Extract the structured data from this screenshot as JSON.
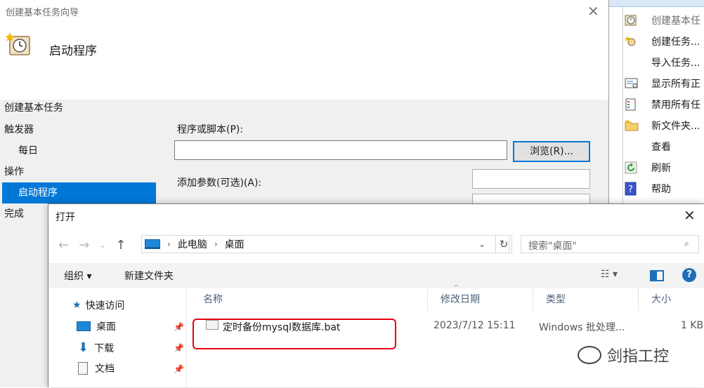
{
  "wizard": {
    "title": "创建基本任务向导",
    "header_title": "启动程序",
    "nav_heading": "创建基本任务",
    "nav_items": [
      {
        "label": "触发器"
      },
      {
        "label": "每日"
      },
      {
        "label": "操作"
      },
      {
        "label": "启动程序"
      },
      {
        "label": "完成"
      }
    ],
    "program_label": "程序或脚本(P):",
    "program_value": "",
    "browse_label": "浏览(R)...",
    "args_label": "添加参数(可选)(A):",
    "args_value": ""
  },
  "action_pane": {
    "items": [
      {
        "label": "创建基本任",
        "icon": "task-wizard-icon",
        "disabled": true
      },
      {
        "label": "创建任务...",
        "icon": "create-task-icon",
        "disabled": false
      },
      {
        "label": "导入任务...",
        "icon": "",
        "disabled": false
      },
      {
        "label": "显示所有正",
        "icon": "running-tasks-icon",
        "disabled": false
      },
      {
        "label": "禁用所有任",
        "icon": "disable-history-icon",
        "disabled": false
      },
      {
        "label": "新文件夹...",
        "icon": "folder-icon",
        "disabled": false
      },
      {
        "label": "查看",
        "icon": "",
        "disabled": false
      },
      {
        "label": "刷新",
        "icon": "refresh-icon",
        "disabled": false
      },
      {
        "label": "帮助",
        "icon": "help-icon",
        "disabled": false
      }
    ]
  },
  "dialog": {
    "title": "打开",
    "address": {
      "root": "此电脑",
      "current": "桌面"
    },
    "search_placeholder": "搜索\"桌面\"",
    "organize_label": "组织 ▾",
    "new_folder_label": "新建文件夹",
    "tree": [
      {
        "label": "快速访问",
        "icon": "star-icon"
      },
      {
        "label": "桌面",
        "icon": "desktop-icon"
      },
      {
        "label": "下载",
        "icon": "download-icon"
      },
      {
        "label": "文档",
        "icon": "document-icon"
      }
    ],
    "columns": {
      "name": "名称",
      "modified": "修改日期",
      "type": "类型",
      "size": "大小"
    },
    "files": [
      {
        "name": "定时备份mysql数据库.bat",
        "modified": "2023/7/12 15:11",
        "type": "Windows 批处理...",
        "size": "1 KB"
      }
    ]
  },
  "watermark": {
    "text": "剑指工控"
  },
  "colors": {
    "accent": "#0078d7",
    "highlight": "#e60012"
  }
}
